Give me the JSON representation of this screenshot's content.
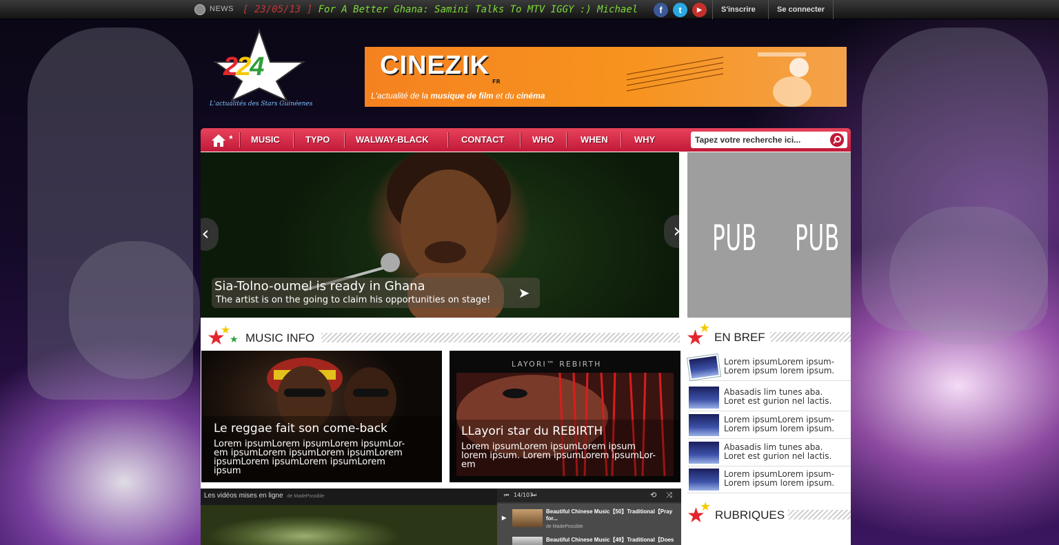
{
  "topbar": {
    "news_label": "NEWS",
    "ticker_date": "[ 23/05/13 ]",
    "ticker_text": "For A Better Ghana: Samini Talks To MTV IGGY  :)  Michael Jackson",
    "social": [
      {
        "icon": "facebook-icon",
        "glyph": "f",
        "color": "#3b5998"
      },
      {
        "icon": "twitter-icon",
        "glyph": "t",
        "color": "#2aa8e0"
      },
      {
        "icon": "youtube-icon",
        "glyph": "▶",
        "color": "#c4302b"
      }
    ],
    "signup_label": "S'inscrire",
    "login_label": "Se connecter"
  },
  "header": {
    "logo_number": "224",
    "logo_tagline": "L'actualités des Stars Guinéenes",
    "banner": {
      "brand": "CINEZIK",
      "brand_suffix": "FR",
      "tagline_pre": "L'actualité de la ",
      "tagline_b1": "musique de film",
      "tagline_mid": " et du ",
      "tagline_b2": "cinéma"
    }
  },
  "nav": {
    "items": [
      "MUSIC",
      "TYPO",
      "WALWAY-BLACK",
      "CONTACT",
      "WHO",
      "WHEN",
      "WHY"
    ],
    "search_placeholder": "Tapez votre recherche ici..."
  },
  "slider": {
    "title": "Sia-Tolno-oumel is ready in Ghana",
    "subtitle": "The artist is on the going to claim his opportunities on stage!"
  },
  "ads": {
    "label": "PUB"
  },
  "music_info": {
    "title": "MUSIC INFO",
    "cards": [
      {
        "title": "Le reggae fait son come-back",
        "body": [
          "Lorem ipsumLorem ipsumLorem ipsumLor-",
          "em ipsumLorem ipsumLorem ipsumLorem",
          "ipsumLorem ipsumLorem ipsumLorem",
          "ipsum"
        ]
      },
      {
        "title": "LLayori star du REBIRTH",
        "album_label": "LAYORI™ REBIRTH",
        "body": [
          "Lorem ipsumLorem ipsumLorem ipsum",
          "lorem ipsum. Lorem ipsumLorem ipsumLor-",
          "em"
        ]
      }
    ]
  },
  "en_bref": {
    "title": "EN BREF",
    "items": [
      [
        "Lorem ipsumLorem ipsum-",
        "Lorem ipsum lorem ipsum."
      ],
      [
        "Abasadis lim tunes aba.",
        "Loret est gurion nel lactis."
      ],
      [
        "Lorem ipsumLorem ipsum-",
        "Lorem ipsum lorem ipsum."
      ],
      [
        "Abasadis lim tunes aba.",
        "Loret est gurion nel lactis."
      ],
      [
        "Lorem ipsumLorem ipsum-",
        "Lorem ipsum lorem ipsum."
      ]
    ]
  },
  "rubriques": {
    "title": "RUBRIQUES"
  },
  "video": {
    "title": "Les vidéos mises en ligne",
    "by": "de MadePossible",
    "counter": "14/107",
    "playlist": [
      {
        "title": "Beautiful Chinese Music【50】Traditional【Pray for...",
        "by": "de MadePossible"
      },
      {
        "title": "Beautiful Chinese Music【49】Traditional【Does",
        "by": ""
      }
    ]
  }
}
